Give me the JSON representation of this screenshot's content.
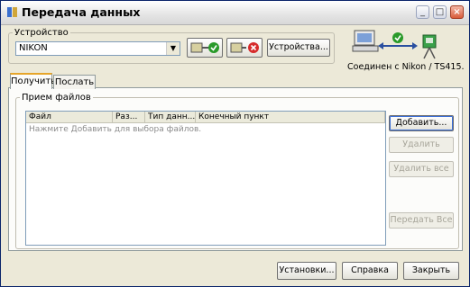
{
  "window": {
    "title": "Передача данных",
    "app_icon": "app-icon"
  },
  "device": {
    "group_label": "Устройство",
    "selected": "NIKON",
    "connect_icon": "connect-icon",
    "disconnect_icon": "disconnect-icon",
    "properties_label": "Устройства..."
  },
  "connection": {
    "status_text": "Соединен с Nikon / TS415.",
    "icons": [
      "computer-icon",
      "connection-ok-icon",
      "total-station-icon"
    ]
  },
  "tabs": [
    {
      "label": "Получить",
      "active": true
    },
    {
      "label": "Послать",
      "active": false
    }
  ],
  "receive": {
    "group_label": "Прием файлов",
    "columns": [
      "Файл",
      "Раз...",
      "Тип данн...",
      "Конечный пункт"
    ],
    "hint": "Нажмите Добавить для выбора файлов.",
    "buttons": {
      "add": "Добавить...",
      "remove": "Удалить",
      "remove_all": "Удалить все",
      "transfer_all": "Передать Все"
    }
  },
  "footer": {
    "settings": "Установки...",
    "help": "Справка",
    "close": "Закрыть"
  },
  "colors": {
    "title_bar": "#e4e4e4",
    "window_bg": "#ece9d8",
    "active_tab_accent": "#e6a52a",
    "ok_green": "#2a9a2a",
    "error_red": "#d62b2b"
  }
}
